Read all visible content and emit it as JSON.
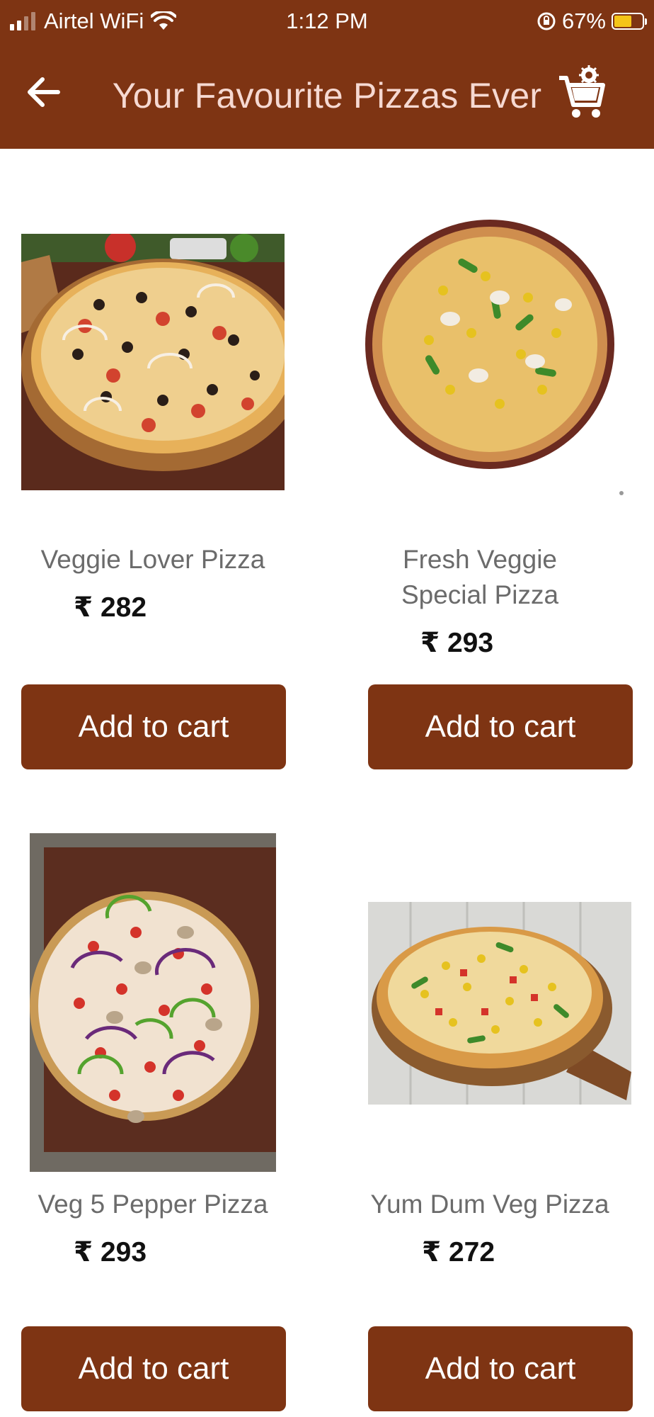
{
  "status_bar": {
    "carrier": "Airtel WiFi",
    "time": "1:12 PM",
    "battery": "67%"
  },
  "header": {
    "title": "Your Favourite Pizzas Ever"
  },
  "colors": {
    "brand": "#7e3413",
    "title_text": "#f6d9d2",
    "name_text": "#6b6b6b"
  },
  "products": [
    {
      "name": "Veggie Lover Pizza",
      "price": "₹ 282",
      "button": "Add to cart"
    },
    {
      "name_line1": "Fresh Veggie",
      "name_line2": "Special Pizza",
      "price": "₹ 293",
      "button": "Add to cart"
    },
    {
      "name": "Veg 5 Pepper Pizza",
      "price": "₹ 293",
      "button": "Add to cart"
    },
    {
      "name": "Yum Dum Veg Pizza",
      "price": "₹ 272",
      "button": "Add to cart"
    }
  ]
}
